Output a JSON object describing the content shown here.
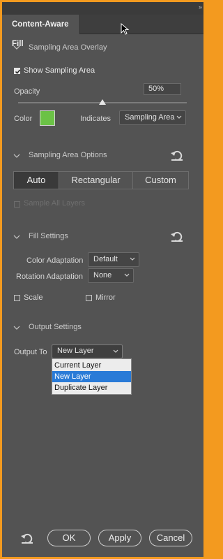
{
  "panel": {
    "tab_title": "Content-Aware Fill",
    "collapse_glyph": "»"
  },
  "overlay": {
    "header": "Sampling Area Overlay",
    "show_label": "Show Sampling Area",
    "show_checked": true,
    "opacity_label": "Opacity",
    "opacity_value": "50%",
    "opacity_level_percent": 50,
    "color_label": "Color",
    "swatch_color": "#6bc246",
    "indicates_label": "Indicates",
    "indicates_value": "Sampling Area"
  },
  "sampling_options": {
    "header": "Sampling Area Options",
    "modes": [
      "Auto",
      "Rectangular",
      "Custom"
    ],
    "selected_mode": "Auto",
    "sample_all_label": "Sample All Layers",
    "sample_all_enabled": false
  },
  "fill_settings": {
    "header": "Fill Settings",
    "color_adaptation_label": "Color Adaptation",
    "color_adaptation_value": "Default",
    "rotation_adaptation_label": "Rotation Adaptation",
    "rotation_adaptation_value": "None",
    "scale_label": "Scale",
    "mirror_label": "Mirror"
  },
  "output": {
    "header": "Output Settings",
    "output_to_label": "Output To",
    "output_to_value": "New Layer",
    "options": [
      "Current Layer",
      "New Layer",
      "Duplicate Layer"
    ],
    "highlighted": "New Layer"
  },
  "footer": {
    "ok_label": "OK",
    "apply_label": "Apply",
    "cancel_label": "Cancel"
  },
  "colors": {
    "accent_orange": "#f39a1f",
    "panel_bg": "#535353",
    "highlight_blue": "#2a7bd7"
  }
}
